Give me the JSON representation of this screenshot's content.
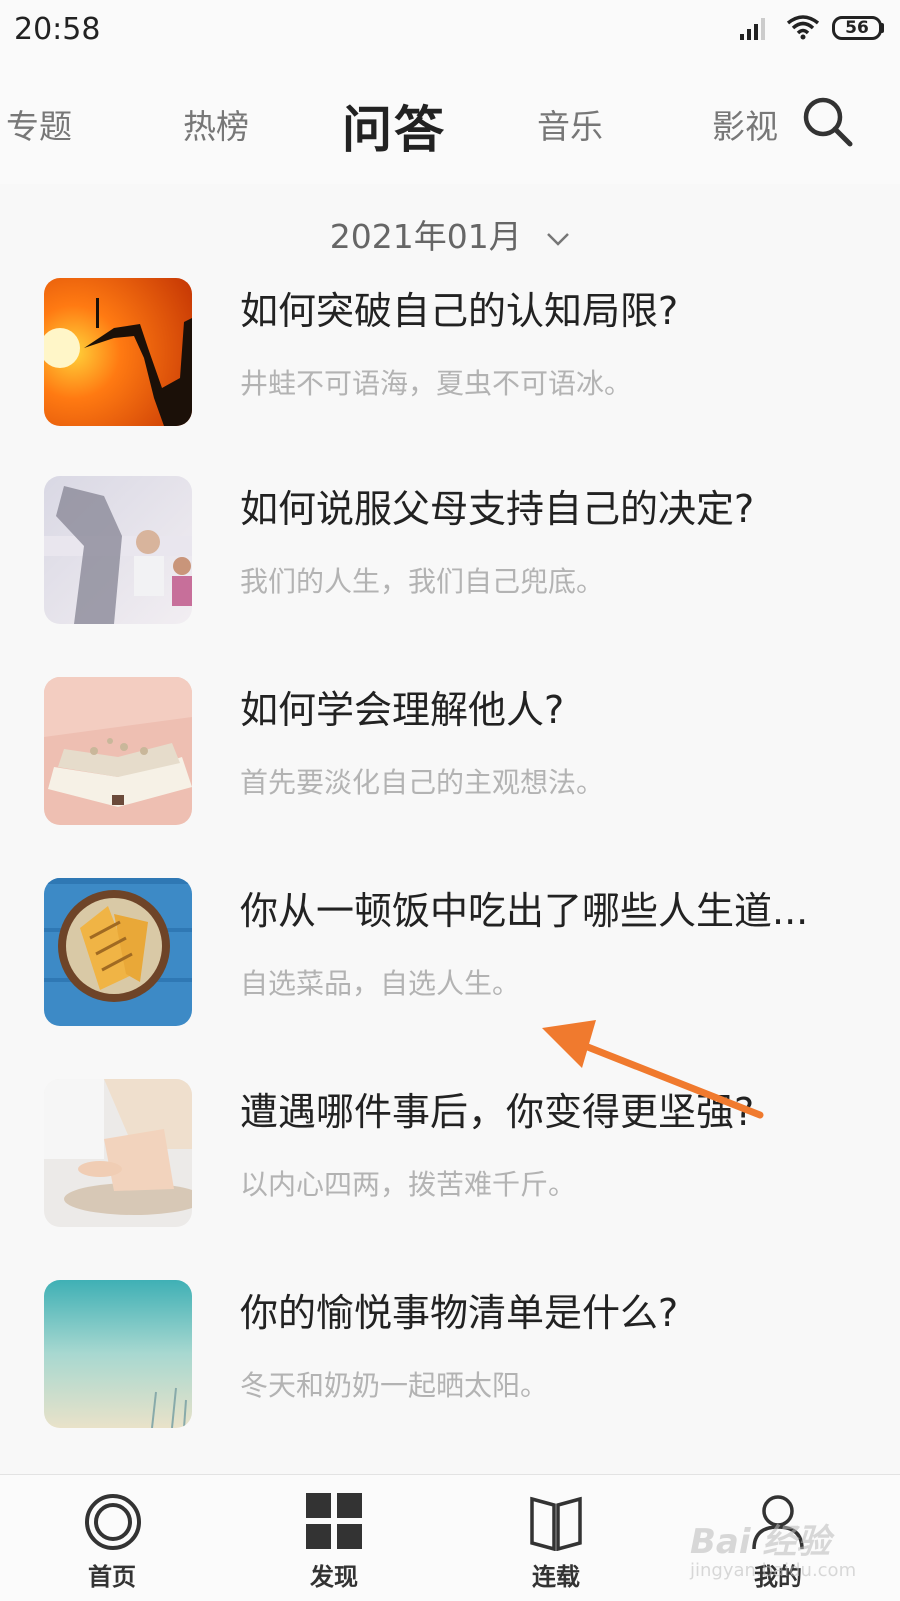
{
  "status_bar": {
    "time": "20:58",
    "battery": "56"
  },
  "top_tabs": [
    {
      "label": "专题",
      "active": false
    },
    {
      "label": "热榜",
      "active": false
    },
    {
      "label": "问答",
      "active": true
    },
    {
      "label": "音乐",
      "active": false
    },
    {
      "label": "影视",
      "active": false
    }
  ],
  "month_selector": {
    "label": "2021年01月"
  },
  "items": [
    {
      "title": "如何突破自己的认知局限?",
      "subtitle": "井蛙不可语海，夏虫不可语冰。",
      "thumb": "robot-sunset-image"
    },
    {
      "title": "如何说服父母支持自己的决定?",
      "subtitle": "我们的人生，我们自己兜底。",
      "thumb": "family-image"
    },
    {
      "title": "如何学会理解他人?",
      "subtitle": "首先要淡化自己的主观想法。",
      "thumb": "open-book-image"
    },
    {
      "title": "你从一顿饭中吃出了哪些人生道...",
      "subtitle": "自选菜品，自选人生。",
      "thumb": "sandwich-image"
    },
    {
      "title": "遭遇哪件事后，你变得更坚强?",
      "subtitle": "以内心四两，拨苦难千斤。",
      "thumb": "baby-image"
    },
    {
      "title": "你的愉悦事物清单是什么?",
      "subtitle": "冬天和奶奶一起晒太阳。",
      "thumb": "beach-image"
    }
  ],
  "bottom_nav": [
    {
      "label": "首页",
      "icon": "home-circle-icon"
    },
    {
      "label": "发现",
      "icon": "grid-icon"
    },
    {
      "label": "连载",
      "icon": "book-icon"
    },
    {
      "label": "我的",
      "icon": "user-icon"
    }
  ],
  "watermark": {
    "text": "Bai 经验",
    "url": "jingyan.baidu.com"
  },
  "colors": {
    "annotation_arrow": "#f07a2e",
    "subtitle": "#b3b3b3"
  }
}
